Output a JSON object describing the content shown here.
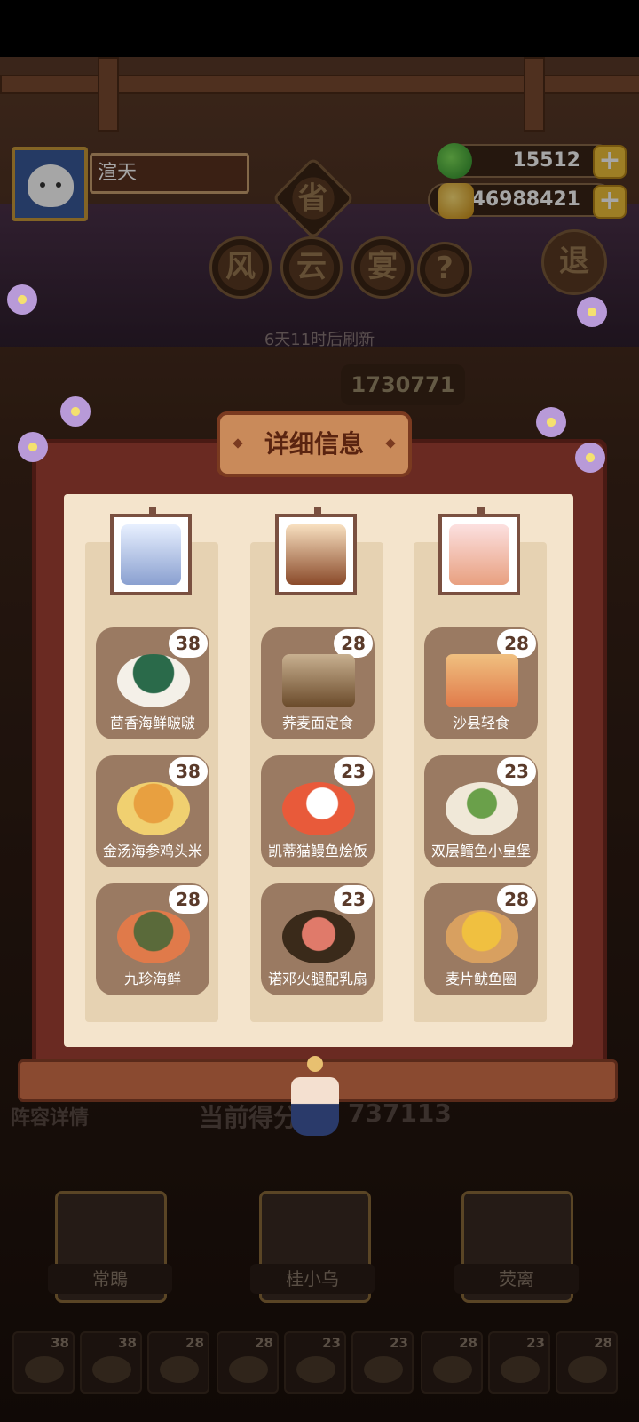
{
  "player": {
    "name": "渲天"
  },
  "currency": {
    "jade": "15512",
    "coins": "46988421",
    "add_label": "+"
  },
  "event": {
    "province_seal": "省",
    "title_chars": [
      "风",
      "云",
      "宴"
    ],
    "help_label": "?",
    "exit_label": "退",
    "refresh_text": "6天11时后刷新",
    "top_score": "1730771"
  },
  "modal": {
    "title": "详细信息",
    "columns": [
      {
        "hero": "常鵖",
        "dishes": [
          {
            "name": "茴香海鲜啵啵",
            "count": "38"
          },
          {
            "name": "金汤海参鸡头米",
            "count": "38"
          },
          {
            "name": "九珍海鲜",
            "count": "28"
          }
        ]
      },
      {
        "hero": "桂小乌",
        "dishes": [
          {
            "name": "荞麦面定食",
            "count": "28"
          },
          {
            "name": "凯蒂猫鳗鱼烩饭",
            "count": "23"
          },
          {
            "name": "诺邓火腿配乳扇",
            "count": "23"
          }
        ]
      },
      {
        "hero": "荧离",
        "dishes": [
          {
            "name": "沙县轻食",
            "count": "28"
          },
          {
            "name": "双层鳕鱼小皇堡",
            "count": "23"
          },
          {
            "name": "麦片鱿鱼圈",
            "count": "28"
          }
        ]
      }
    ]
  },
  "background": {
    "lineup_label": "阵容详情",
    "current_score_label": "当前得分",
    "current_score_partial": "737113",
    "heroes": [
      "常鵖",
      "桂小乌",
      "荧离"
    ],
    "thumb_counts": [
      "38",
      "38",
      "28",
      "28",
      "23",
      "23",
      "28",
      "23",
      "28"
    ]
  },
  "colors": {
    "modal_frame": "#6a2a22",
    "modal_inner": "#f4e4cc",
    "dish_card": "#9a7a62",
    "header": "#c98a5a"
  }
}
